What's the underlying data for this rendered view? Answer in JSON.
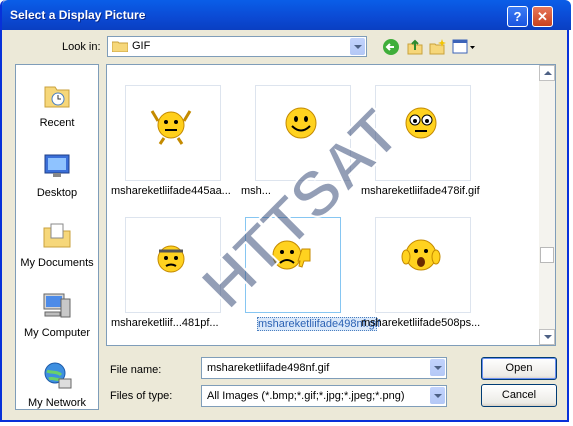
{
  "window": {
    "title": "Select a Display Picture",
    "help_label": "?",
    "close_label": "✕"
  },
  "toolbar": {
    "look_in_label": "Look in:",
    "look_in_value": "GIF",
    "icons": [
      "back-icon",
      "up-folder-icon",
      "new-folder-icon",
      "view-menu-icon"
    ]
  },
  "places": [
    {
      "label": "Recent",
      "icon": "recent-icon"
    },
    {
      "label": "Desktop",
      "icon": "desktop-icon"
    },
    {
      "label": "My Documents",
      "icon": "my-documents-icon"
    },
    {
      "label": "My Computer",
      "icon": "my-computer-icon"
    },
    {
      "label": "My Network",
      "icon": "my-network-icon"
    }
  ],
  "files": [
    {
      "name": "mshareketliifade445aa...",
      "selected": false
    },
    {
      "name": "msh...",
      "selected": false
    },
    {
      "name": "mshareketliifade478if.gif",
      "selected": false
    },
    {
      "name": "mshareketliif...481pf...",
      "selected": false
    },
    {
      "name": "mshareketliifade498nf.gif",
      "selected": true
    },
    {
      "name": "mshareketliifade508ps...",
      "selected": false
    }
  ],
  "file_name": {
    "label": "File name:",
    "value": "mshareketliifade498nf.gif"
  },
  "file_type": {
    "label": "Files of type:",
    "value": "All Images (*.bmp;*.gif;*.jpg;*.jpeg;*.png)"
  },
  "buttons": {
    "open": "Open",
    "cancel": "Cancel"
  },
  "watermark": {
    "text": "HTTSAT"
  },
  "colors": {
    "title_bar": "#0b49d3",
    "selection": "#dbe9fa",
    "dialog_bg": "#ece9d8"
  }
}
